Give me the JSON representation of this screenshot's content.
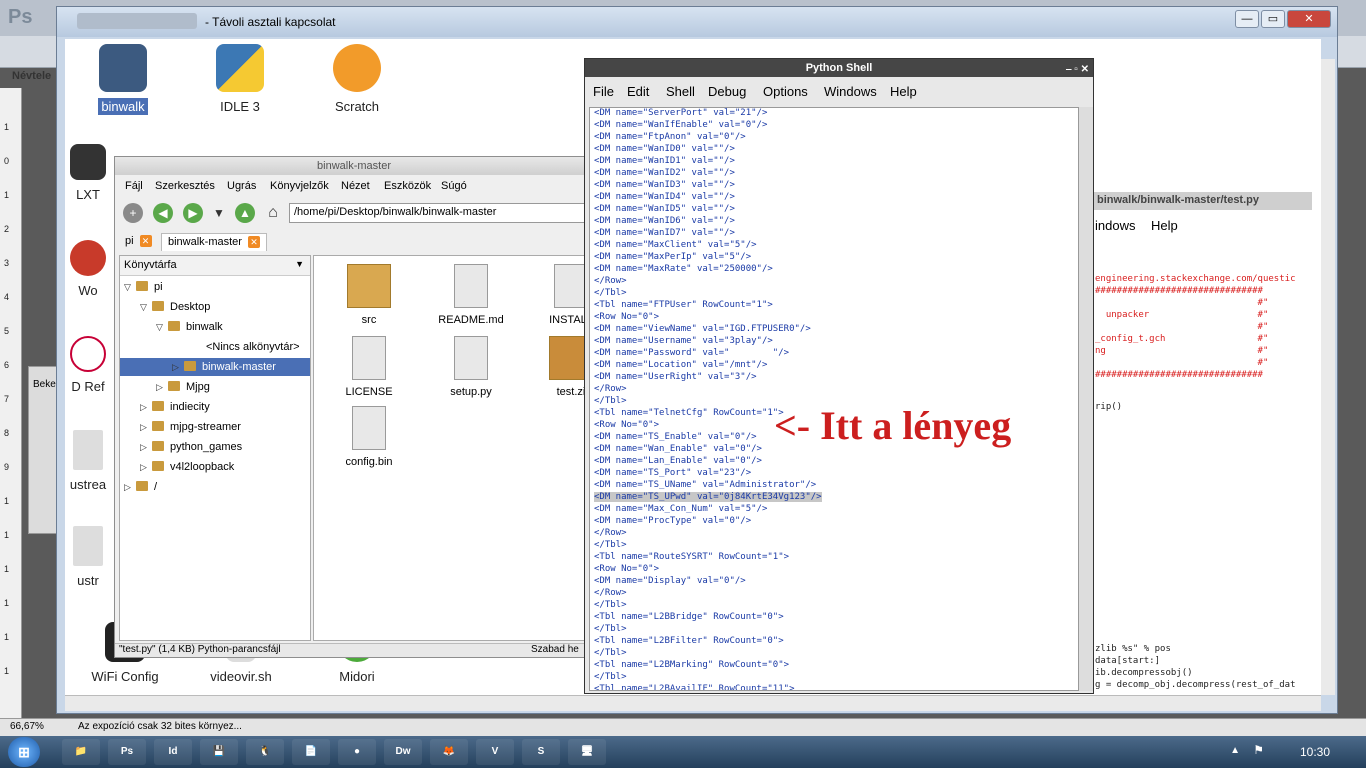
{
  "photoshop": {
    "logo": "Ps",
    "doc_tab": "Névtele",
    "zoom": "66,67%",
    "status_info": "Az expozíció csak 32 bites környez...",
    "panel_label": "Beke",
    "ruler_numbers": [
      "1",
      "0",
      "1",
      "2",
      "3",
      "4",
      "5",
      "6",
      "7",
      "8",
      "9",
      "1",
      "1",
      "1",
      "1",
      "1",
      "1"
    ]
  },
  "rdp": {
    "title": "- Távoli asztali kapcsolat",
    "buttons": {
      "minimize": "—",
      "maximize": "▭",
      "close": "✕"
    }
  },
  "desktop_icons": [
    {
      "label": "binwalk",
      "selected": true
    },
    {
      "label": "IDLE 3",
      "selected": false
    },
    {
      "label": "Scratch",
      "selected": false
    },
    {
      "label": "LXT",
      "selected": false
    },
    {
      "label": "Wo",
      "selected": false
    },
    {
      "label": "D Ref",
      "selected": false
    },
    {
      "label": "ustrea",
      "selected": false
    },
    {
      "label": "ustr",
      "selected": false
    },
    {
      "label": "WiFi Config",
      "selected": false
    },
    {
      "label": "videovir.sh",
      "selected": false
    },
    {
      "label": "Midori",
      "selected": false
    }
  ],
  "file_manager": {
    "title": "binwalk-master",
    "menu": [
      "Fájl",
      "Szerkesztés",
      "Ugrás",
      "Könyvjelzők",
      "Nézet",
      "Eszközök",
      "Súgó"
    ],
    "path": "/home/pi/Desktop/binwalk/binwalk-master",
    "tabs": [
      "pi",
      "binwalk-master"
    ],
    "sidebar_header": "Könyvtárfa",
    "tree": [
      {
        "label": "pi",
        "arrow": "▽"
      },
      {
        "label": "Desktop",
        "arrow": "▽"
      },
      {
        "label": "binwalk",
        "arrow": "▽"
      },
      {
        "label": "<Nincs alkönyvtár>",
        "arrow": ""
      },
      {
        "label": "binwalk-master",
        "arrow": "▷"
      },
      {
        "label": "Mjpg",
        "arrow": "▷"
      },
      {
        "label": "indiecity",
        "arrow": "▷"
      },
      {
        "label": "mjpg-streamer",
        "arrow": "▷"
      },
      {
        "label": "python_games",
        "arrow": "▷"
      },
      {
        "label": "v4l2loopback",
        "arrow": "▷"
      },
      {
        "label": "/",
        "arrow": "▷"
      }
    ],
    "files": [
      "src",
      "README.md",
      "INSTALL",
      "LICENSE",
      "setup.py",
      "test.zi",
      "config.bin"
    ],
    "status": "\"test.py\" (1,4 KB) Python-parancsfájl",
    "status_right": "Szabad he"
  },
  "python_shell": {
    "title": "Python Shell",
    "controls": "‒ ▫ ✕",
    "menu": [
      "File",
      "Edit",
      "Shell",
      "Debug",
      "Options",
      "Windows",
      "Help"
    ],
    "code_lines": [
      "<DM name=\"ServerPort\" val=\"21\"/>",
      "<DM name=\"WanIfEnable\" val=\"0\"/>",
      "<DM name=\"FtpAnon\" val=\"0\"/>",
      "<DM name=\"WanID0\" val=\"\"/>",
      "<DM name=\"WanID1\" val=\"\"/>",
      "<DM name=\"WanID2\" val=\"\"/>",
      "<DM name=\"WanID3\" val=\"\"/>",
      "<DM name=\"WanID4\" val=\"\"/>",
      "<DM name=\"WanID5\" val=\"\"/>",
      "<DM name=\"WanID6\" val=\"\"/>",
      "<DM name=\"WanID7\" val=\"\"/>",
      "<DM name=\"MaxClient\" val=\"5\"/>",
      "<DM name=\"MaxPerIp\" val=\"5\"/>",
      "<DM name=\"MaxRate\" val=\"250000\"/>",
      "</Row>",
      "</Tbl>",
      "<Tbl name=\"FTPUser\" RowCount=\"1\">",
      "<Row No=\"0\">",
      "<DM name=\"ViewName\" val=\"IGD.FTPUSER0\"/>",
      "<DM name=\"Username\" val=\"3play\"/>",
      "<DM name=\"Password\" val=\"        \"/>",
      "<DM name=\"Location\" val=\"/mnt\"/>",
      "<DM name=\"UserRight\" val=\"3\"/>",
      "</Row>",
      "</Tbl>",
      "<Tbl name=\"TelnetCfg\" RowCount=\"1\">",
      "<Row No=\"0\">",
      "<DM name=\"TS_Enable\" val=\"0\"/>",
      "<DM name=\"Wan_Enable\" val=\"0\"/>",
      "<DM name=\"Lan_Enable\" val=\"0\"/>",
      "<DM name=\"TS_Port\" val=\"23\"/>",
      "<DM name=\"TS_UName\" val=\"Administrator\"/>",
      "<DM name=\"TS_UPwd\" val=\"0j84KrtE34Vg123\"/>",
      "<DM name=\"Max_Con_Num\" val=\"5\"/>",
      "<DM name=\"ProcType\" val=\"0\"/>",
      "</Row>",
      "</Tbl>",
      "<Tbl name=\"RouteSYSRT\" RowCount=\"1\">",
      "<Row No=\"0\">",
      "<DM name=\"Display\" val=\"0\"/>",
      "</Row>",
      "</Tbl>",
      "<Tbl name=\"L2BBridge\" RowCount=\"0\">",
      "</Tbl>",
      "<Tbl name=\"L2BFilter\" RowCount=\"0\">",
      "</Tbl>",
      "<Tbl name=\"L2BMarking\" RowCount=\"0\">",
      "</Tbl>",
      "<Tbl name=\"L2BAvailIF\" RowCount=\"11\">"
    ],
    "highlight_line": 32,
    "annotation": "<- Itt a lényeg"
  },
  "idle_editor": {
    "title": "binwalk/binwalk-master/test.py",
    "menu": [
      "indows",
      "Help"
    ],
    "lines": [
      {
        "text": "engineering.stackexchange.com/questic",
        "color": "#d92020"
      },
      {
        "text": "###############################",
        "color": "#d92020"
      },
      {
        "text": "                              #\"",
        "color": "#d92020"
      },
      {
        "text": "  unpacker                    #\"",
        "color": "#d92020"
      },
      {
        "text": "                              #\"",
        "color": "#d92020"
      },
      {
        "text": "_config_t.gch                 #\"",
        "color": "#d92020"
      },
      {
        "text": "ng                            #\"",
        "color": "#d92020"
      },
      {
        "text": "                              #\"",
        "color": "#d92020"
      },
      {
        "text": "###############################",
        "color": "#d92020"
      },
      {
        "text": "rip()",
        "color": "#222222"
      },
      {
        "text": "zlib %s\" % pos",
        "color": "#222222"
      },
      {
        "text": "data[start:]",
        "color": "#222222"
      },
      {
        "text": "ib.decompressobj()",
        "color": "#222222"
      },
      {
        "text": "g = decomp_obj.decompress(rest_of_dat",
        "color": "#222222"
      }
    ]
  },
  "taskbar": {
    "start": "⊞",
    "items": [
      "📁",
      "Ps",
      "Id",
      "💾",
      "🐧",
      "📄",
      "●",
      "Dw",
      "🦊",
      "V",
      "S",
      "🖥"
    ],
    "clock": "10:30"
  },
  "colors": {
    "annotation": "#cc1f1f",
    "code": "#1a3aa6",
    "selection": "#4a6fb5"
  }
}
